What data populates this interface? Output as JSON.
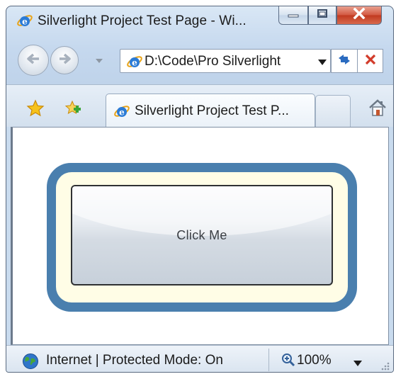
{
  "window": {
    "title": "Silverlight Project Test Page - Wi...",
    "caption_buttons": {
      "minimize_icon": "minimize-icon",
      "maximize_icon": "maximize-icon",
      "close_icon": "close-icon"
    }
  },
  "navigation": {
    "back_icon": "back-arrow-icon",
    "forward_icon": "forward-arrow-icon",
    "address": "D:\\Code\\Pro Silverlight",
    "refresh_icon": "refresh-icon",
    "stop_icon": "stop-icon"
  },
  "tabs": {
    "active_tab_label": "Silverlight Project Test P...",
    "favorites_icon": "star-icon",
    "add_favorites_icon": "add-favorites-icon",
    "home_icon": "home-icon"
  },
  "content": {
    "button_label": "Click Me",
    "colors": {
      "outer_border": "#4a7fae",
      "inner_fill": "#fffde6",
      "button_border": "#2f3133"
    }
  },
  "statusbar": {
    "zone_text": "Internet | Protected Mode: On",
    "zoom": "100%",
    "globe_icon": "globe-icon",
    "zoom_icon": "zoom-icon"
  }
}
